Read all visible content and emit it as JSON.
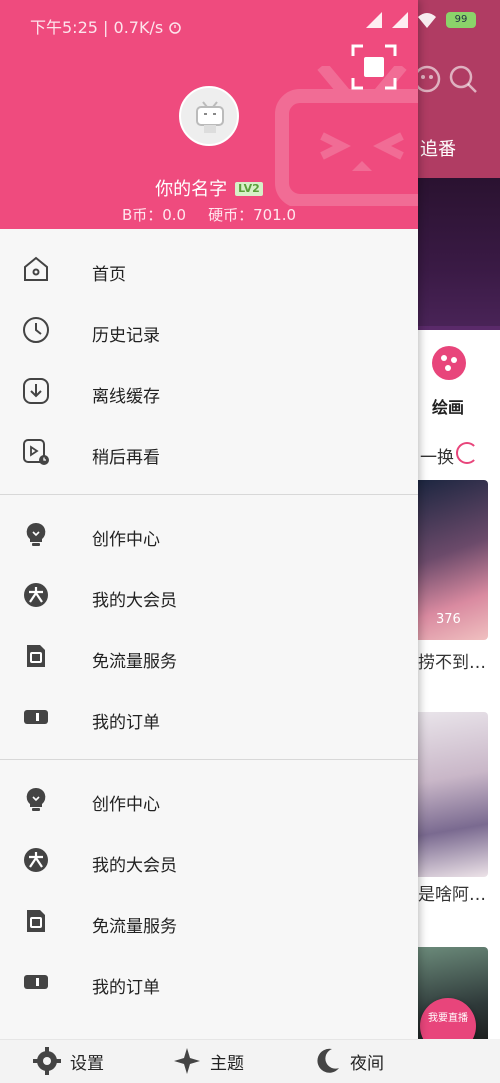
{
  "status_bar": {
    "time": "下午5:25",
    "network_speed": "0.7K/s",
    "battery": "99"
  },
  "background": {
    "tab_label": "追番",
    "paint_label": "绘画",
    "refresh_label": "一换",
    "card1_count": "376",
    "card1_title": "捞不到…",
    "card2_title": "是啥阿…",
    "fab_text": "我要直播"
  },
  "drawer": {
    "user": {
      "name": "你的名字",
      "level": "LV2",
      "b_coin": "B币：0.0",
      "hard_coin": "硬币：701.0"
    },
    "menu_groups": [
      [
        {
          "label": "首页",
          "icon": "home-icon"
        },
        {
          "label": "历史记录",
          "icon": "clock-icon"
        },
        {
          "label": "离线缓存",
          "icon": "download-icon"
        },
        {
          "label": "稍后再看",
          "icon": "watch-later-icon"
        }
      ],
      [
        {
          "label": "创作中心",
          "icon": "lightbulb-icon"
        },
        {
          "label": "我的大会员",
          "icon": "vip-icon"
        },
        {
          "label": "免流量服务",
          "icon": "sim-card-icon"
        },
        {
          "label": "我的订单",
          "icon": "ticket-icon"
        }
      ],
      [
        {
          "label": "创作中心",
          "icon": "lightbulb-icon"
        },
        {
          "label": "我的大会员",
          "icon": "vip-icon"
        },
        {
          "label": "免流量服务",
          "icon": "sim-card-icon"
        },
        {
          "label": "我的订单",
          "icon": "ticket-icon"
        }
      ]
    ]
  },
  "bottom_bar": {
    "settings": "设置",
    "theme": "主题",
    "night": "夜间"
  },
  "colors": {
    "brand_pink": "#ef4b7e",
    "header_dim": "#b03c63",
    "level_badge_bg": "#d7f0c8"
  }
}
